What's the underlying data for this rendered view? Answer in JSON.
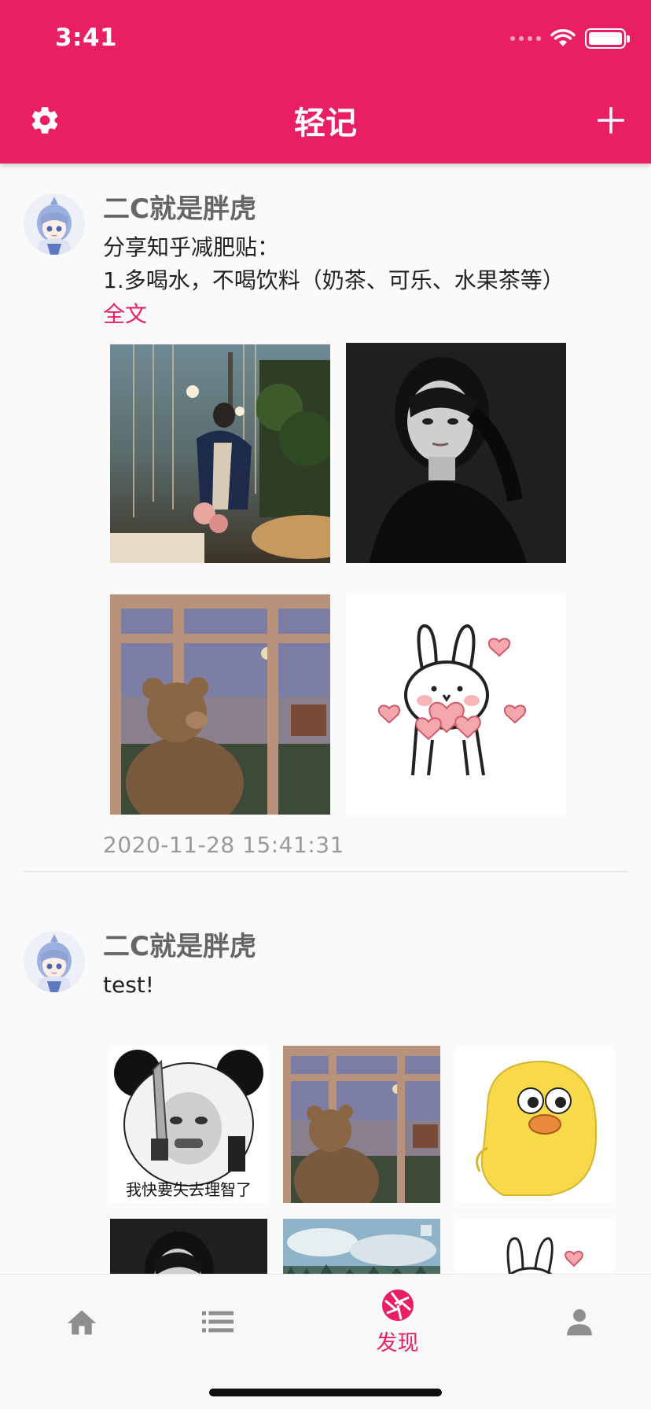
{
  "status_bar": {
    "time": "3:41"
  },
  "header": {
    "title": "轻记",
    "settings_icon": "gear-icon",
    "add_icon": "plus-icon",
    "accent_color": "#e91e63"
  },
  "posts": [
    {
      "author": "二C就是胖虎",
      "text_lines": [
        "分享知乎减肥贴：",
        "1.多喝水，不喝饮料（奶茶、可乐、水果茶等）"
      ],
      "full_text_link": "全文",
      "timestamp": "2020-11-28 15:41:31",
      "photos": [
        "woman-by-lake-photo",
        "black-white-portrait-photo",
        "teddy-bear-window-photo",
        "bunny-hearts-sticker"
      ]
    },
    {
      "author": "二C就是胖虎",
      "text_lines": [
        "test!"
      ],
      "photos": [
        "panda-meme-photo",
        "teddy-bear-window-photo",
        "yellow-duck-sticker",
        "black-white-portrait-photo",
        "forest-sky-photo",
        "bunny-hearts-sticker"
      ],
      "meme_caption": "我快要失去理智了"
    }
  ],
  "tabbar": {
    "tabs": [
      {
        "icon": "home-icon",
        "label": ""
      },
      {
        "icon": "list-icon",
        "label": ""
      },
      {
        "icon": "aperture-icon",
        "label": "发现",
        "active": true
      },
      {
        "icon": "person-icon",
        "label": ""
      }
    ],
    "active_color": "#e91e63",
    "inactive_color": "#8e8e8e"
  }
}
